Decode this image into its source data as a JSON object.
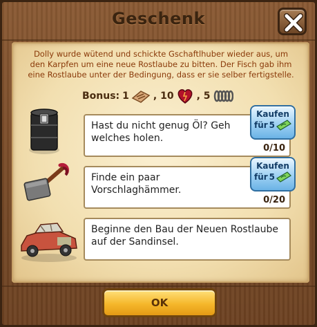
{
  "dialog": {
    "title": "Geschenk",
    "intro": "Dolly wurde wütend und schickte Gschaftlhuber wieder aus, um den Karpfen um eine neue Rostlaube zu bitten. Der Fisch gab ihm eine Rostlaube unter der Bedingung, dass er sie selber fertigstelle.",
    "ok_label": "OK"
  },
  "bonus": {
    "label": "Bonus:",
    "items": [
      {
        "amount": "1",
        "icon": "building-kit-icon"
      },
      {
        "amount": ", 10",
        "icon": "heart-icon"
      },
      {
        "amount": ", 5",
        "icon": "spring-coil-icon"
      }
    ]
  },
  "tasks": [
    {
      "icon": "oil-barrel-icon",
      "text": "Hast du nicht genug Öl? Geh welches holen.",
      "progress": "0/10",
      "buy": {
        "label": "Kaufen",
        "prefix": "für",
        "price": "5",
        "currency_icon": "ticket-icon"
      }
    },
    {
      "icon": "sledgehammer-icon",
      "text": "Finde ein paar Vorschlaghämmer.",
      "progress": "0/20",
      "buy": {
        "label": "Kaufen",
        "prefix": "für",
        "price": "5",
        "currency_icon": "ticket-icon"
      }
    },
    {
      "icon": "old-car-icon",
      "text": "Beginne den Bau der Neuen Rostlaube auf der Sandinsel."
    }
  ],
  "colors": {
    "wood": "#7a4c29",
    "parchment": "#f2dfb0",
    "intro_text": "#8a3a0a",
    "buy_button": "#9fd1f3",
    "ok_button": "#f5b72b"
  }
}
